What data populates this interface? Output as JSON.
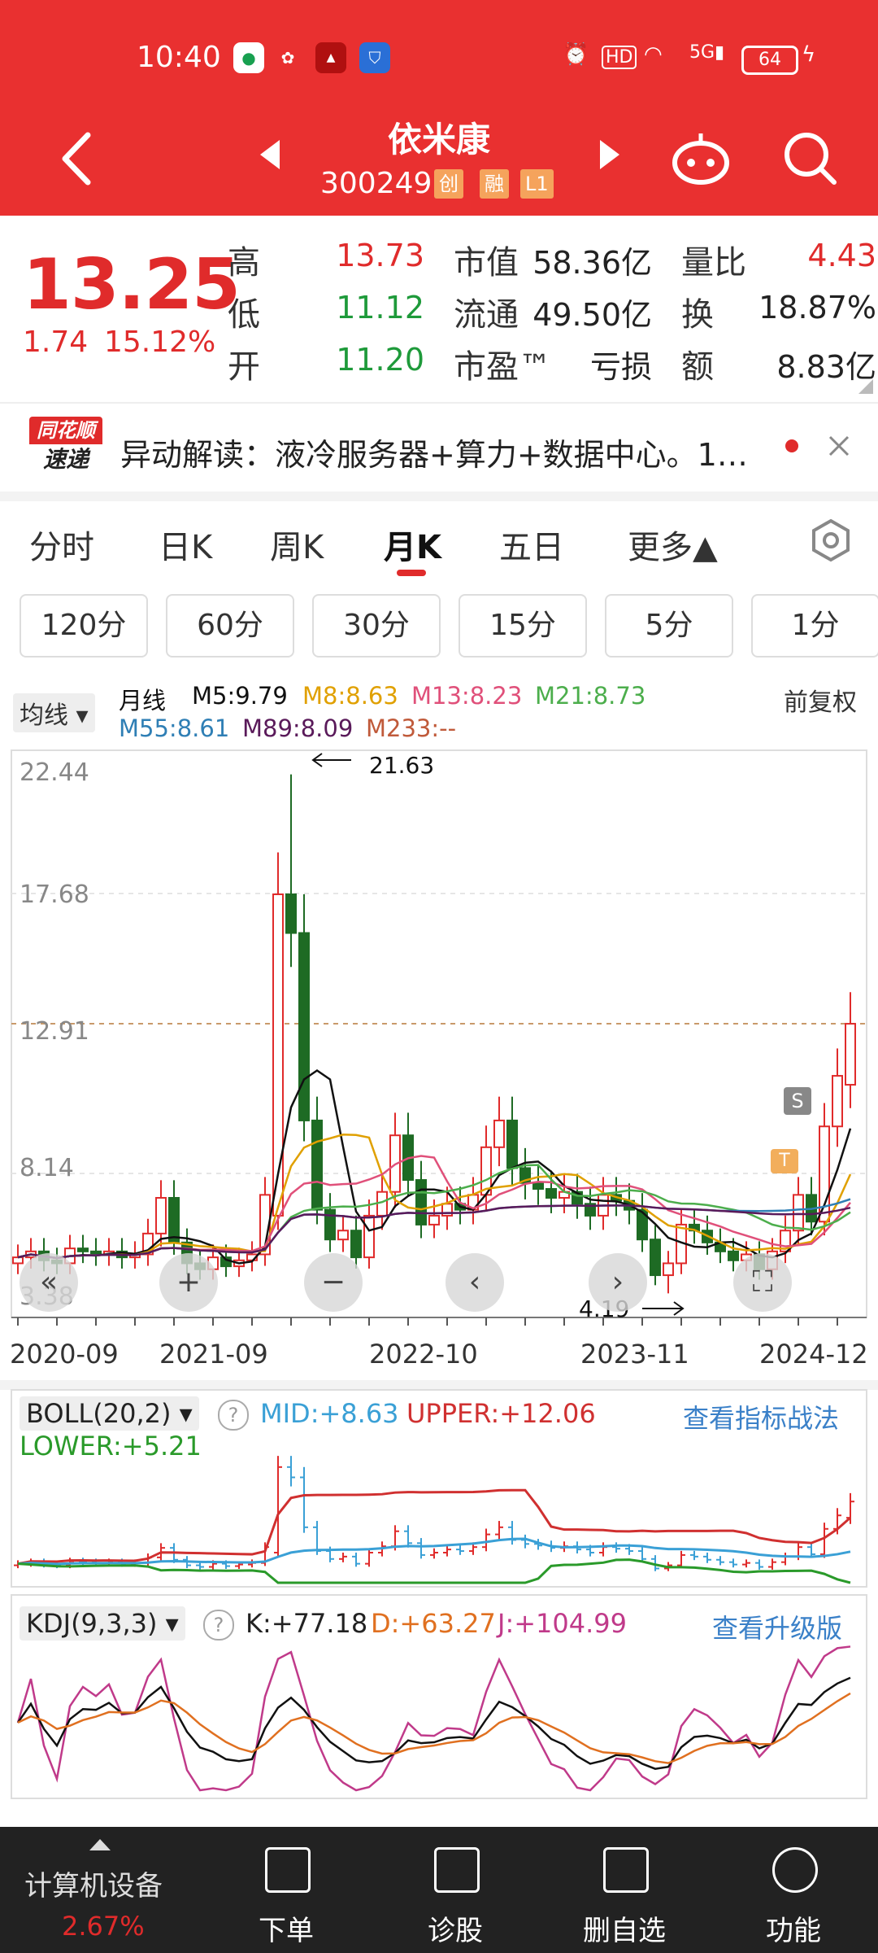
{
  "status": {
    "time": "10:40",
    "signal": "5G",
    "battery": "64"
  },
  "header": {
    "stock_name": "依米康",
    "stock_code": "300249",
    "badges": [
      "创",
      "融",
      "L1"
    ]
  },
  "quote": {
    "price": "13.25",
    "change": "1.74",
    "change_pct": "15.12%",
    "high_label": "高",
    "high": "13.73",
    "low_label": "低",
    "low": "11.12",
    "open_label": "开",
    "open": "11.20",
    "mcap_label": "市值",
    "mcap": "58.36亿",
    "float_label": "流通",
    "float": "49.50亿",
    "pe_label": "市盈™",
    "pe": "亏损",
    "vr_label": "量比",
    "vr": "4.43",
    "turn_label": "换",
    "turn": "18.87%",
    "amt_label": "额",
    "amt": "8.83亿"
  },
  "news": {
    "brand_top": "同花顺",
    "brand_bottom": "速递",
    "text": "异动解读：液冷服务器+算力+数据中心。1…"
  },
  "tabs": [
    "分时",
    "日K",
    "周K",
    "月K",
    "五日",
    "更多▲"
  ],
  "subtabs": [
    "120分",
    "60分",
    "30分",
    "15分",
    "5分",
    "1分"
  ],
  "ma_bar": {
    "selector": "均线 ▾",
    "period": "月线",
    "adjust": "前复权",
    "items": [
      {
        "label": "M5:9.79",
        "color": "#111111"
      },
      {
        "label": "M8:8.63",
        "color": "#e0a000"
      },
      {
        "label": "M13:8.23",
        "color": "#e0507a"
      },
      {
        "label": "M21:8.73",
        "color": "#4cae4c"
      },
      {
        "label": "M55:8.61",
        "color": "#2f7fb5"
      },
      {
        "label": "M89:8.09",
        "color": "#5a1a5a"
      },
      {
        "label": "M233:--",
        "color": "#c05a3a"
      }
    ]
  },
  "main_chart": {
    "y_labels": [
      "22.44",
      "17.68",
      "12.91",
      "8.14",
      "3.38"
    ],
    "x_labels": [
      "2020-09",
      "2021-09",
      "2022-10",
      "2023-11",
      "2024-12"
    ],
    "max_label": "21.63",
    "min_label": "4.19",
    "marker_s": "S",
    "marker_t": "T"
  },
  "boll": {
    "selector": "BOLL(20,2) ▾",
    "mid": "MID:+8.63",
    "upper": "UPPER:+12.06",
    "lower": "LOWER:+5.21",
    "link": "查看指标战法"
  },
  "kdj": {
    "selector": "KDJ(9,3,3) ▾",
    "k": "K:+77.18",
    "d": "D:+63.27",
    "j": "J:+104.99",
    "link": "查看升级版"
  },
  "bottom": {
    "sector": "计算机设备",
    "sector_pct": "2.67%",
    "items": [
      "下单",
      "诊股",
      "删自选",
      "功能"
    ]
  },
  "colors": {
    "header": "#e93030",
    "up": "#e02b2b",
    "down": "#1e7a2a"
  }
}
